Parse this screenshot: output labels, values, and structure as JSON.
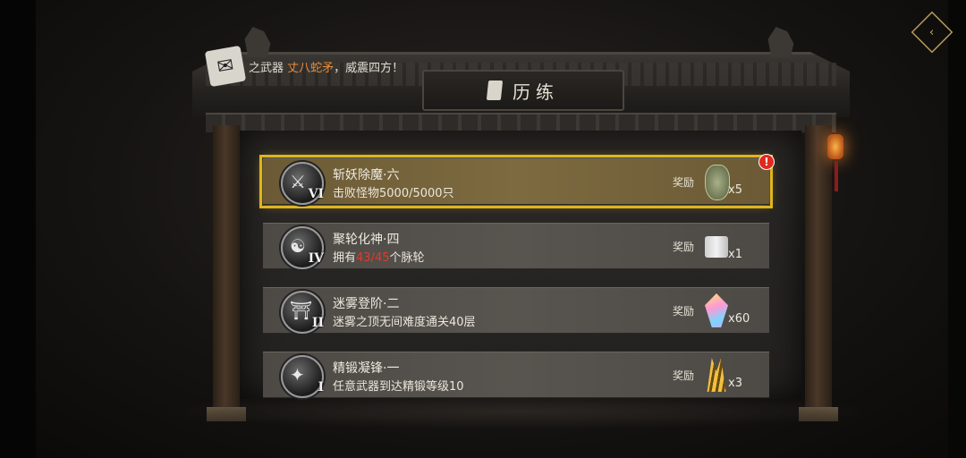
{
  "notice": {
    "icon": "scroll-icon",
    "prefix": "之武器 ",
    "highlight": "丈八蛇矛",
    "suffix": "，威震四方！"
  },
  "title": {
    "text": "历练",
    "icon": "scroll-icon"
  },
  "reward_label": "奖励",
  "quests": [
    {
      "title": "斩妖除魔·六",
      "numeral": "VI",
      "desc": "击败怪物5000/5000只",
      "reward_icon": "jade-token-icon",
      "reward_count": "x5",
      "active": true,
      "alert": "!"
    },
    {
      "title": "聚轮化神·四",
      "numeral": "IV",
      "desc_prefix": "拥有",
      "desc_red": "43/45",
      "desc_suffix": "个脉轮",
      "reward_icon": "scroll-item-icon",
      "reward_count": "x1"
    },
    {
      "title": "迷雾登阶·二",
      "numeral": "II",
      "desc": "迷雾之顶无间难度通关40层",
      "reward_icon": "crystal-icon",
      "reward_count": "x60"
    },
    {
      "title": "精锻凝锋·一",
      "numeral": "I",
      "desc": "任意武器到达精锻等级10",
      "reward_icon": "gold-shards-icon",
      "reward_count": "x3"
    }
  ],
  "colors": {
    "accent": "#e0b41e",
    "highlight": "#e88c3a",
    "progress_red": "#e23a2a"
  }
}
